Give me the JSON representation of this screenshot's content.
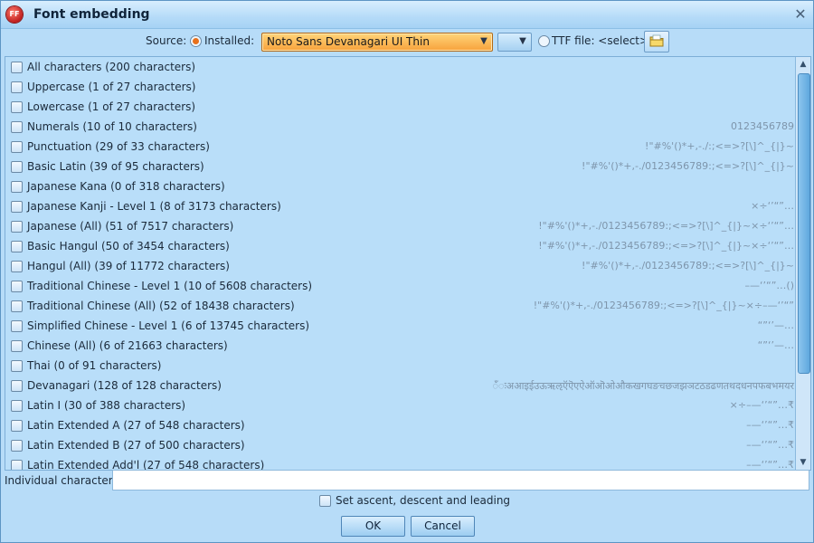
{
  "window": {
    "title": "Font embedding",
    "logo_text": "FF"
  },
  "source": {
    "label": "Source:",
    "installed_label": "Installed:",
    "installed_checked": true,
    "font_value": "Noto Sans Devanagari UI Thin",
    "ttf_label": "TTF file: <select>",
    "ttf_checked": false
  },
  "rows": [
    {
      "name": "All characters (200 characters)",
      "sample": ""
    },
    {
      "name": "Uppercase (1 of 27 characters)",
      "sample": ""
    },
    {
      "name": "Lowercase (1 of 27 characters)",
      "sample": ""
    },
    {
      "name": "Numerals (10 of 10 characters)",
      "sample": "0123456789"
    },
    {
      "name": "Punctuation (29 of 33 characters)",
      "sample": "!\"#%'()*+,-./:;<=>?[\\]^_{|}~"
    },
    {
      "name": "Basic Latin (39 of 95 characters)",
      "sample": "!\"#%'()*+,-./0123456789:;<=>?[\\]^_{|}~"
    },
    {
      "name": "Japanese Kana (0 of 318 characters)",
      "sample": ""
    },
    {
      "name": "Japanese Kanji - Level 1 (8 of 3173 characters)",
      "sample": "×÷‘’“”…"
    },
    {
      "name": "Japanese (All) (51 of 7517 characters)",
      "sample": "!\"#%'()*+,-./0123456789:;<=>?[\\]^_{|}~×÷‘’“”…"
    },
    {
      "name": "Basic Hangul (50 of 3454 characters)",
      "sample": "!\"#%'()*+,-./0123456789:;<=>?[\\]^_{|}~×÷‘’“”…"
    },
    {
      "name": "Hangul (All) (39 of 11772 characters)",
      "sample": "!\"#%'()*+,-./0123456789:;<=>?[\\]^_{|}~"
    },
    {
      "name": "Traditional Chinese - Level 1 (10 of 5608 characters)",
      "sample": "–—‘’“”…()"
    },
    {
      "name": "Traditional Chinese (All) (52 of 18438 characters)",
      "sample": "!\"#%'()*+,-./0123456789:;<=>?[\\]^_{|}~×÷–—‘’“”"
    },
    {
      "name": "Simplified Chinese - Level 1 (6 of 13745 characters)",
      "sample": "“”‘’—…"
    },
    {
      "name": "Chinese (All) (6 of 21663 characters)",
      "sample": "“”‘’—…"
    },
    {
      "name": "Thai (0 of 91 characters)",
      "sample": ""
    },
    {
      "name": "Devanagari (128 of 128 characters)",
      "sample": "ँंःअआइईउऊऋऌऍऎएऐऑऒओऔकखगघङचछजझञटठडढणतथदधनपफबभमयर"
    },
    {
      "name": "Latin I (30 of 388 characters)",
      "sample": "×÷–—‘’“”…₹"
    },
    {
      "name": "Latin Extended A (27 of 548 characters)",
      "sample": "–—‘’“”…₹"
    },
    {
      "name": "Latin Extended B (27 of 500 characters)",
      "sample": "–—‘’“”…₹"
    },
    {
      "name": "Latin Extended Add'l (27 of 548 characters)",
      "sample": "–—‘’“”…₹"
    }
  ],
  "individual": {
    "label": "Individual characters:",
    "value": ""
  },
  "ascent_label": "Set ascent, descent and leading",
  "buttons": {
    "ok": "OK",
    "cancel": "Cancel"
  },
  "colors": {
    "selection_orange": "#f7a23b",
    "list_bg": "#b9def9",
    "window_bg": "#b7dcf8"
  }
}
